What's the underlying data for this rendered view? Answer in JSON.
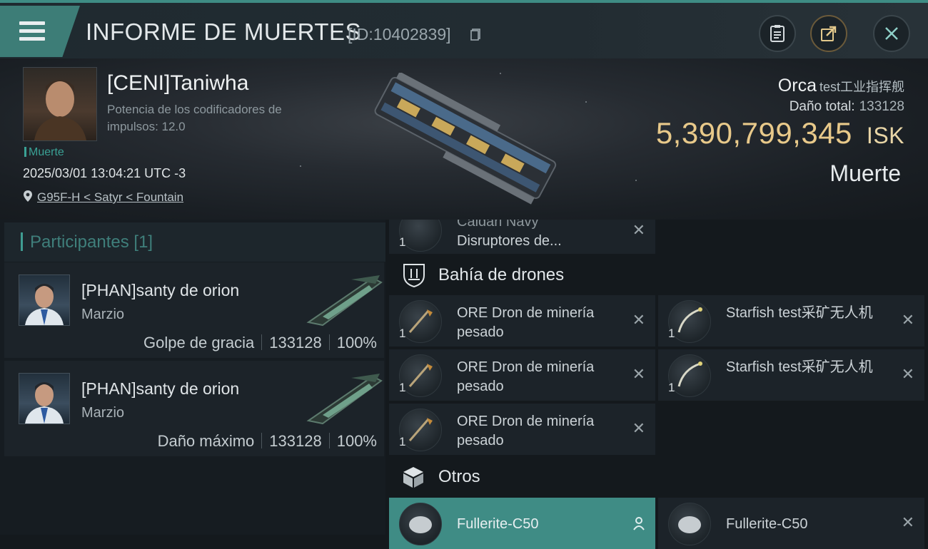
{
  "header": {
    "title": "INFORME DE MUERTES",
    "kill_id": "[ID:10402839]"
  },
  "victim": {
    "name": "[CENI]Taniwha",
    "ship_attribute": "Potencia de los codificadores de impulsos: 12.0",
    "badge": "Muerte",
    "datetime": "2025/03/01 13:04:21 UTC -3",
    "location": "G95F-H < Satyr < Fountain",
    "ship_name": "Orca",
    "ship_subtitle": "test工业指挥舰",
    "damage_label": "Daño total:",
    "damage_value": "133128",
    "isk_value": "5,390,799,345",
    "isk_unit": "ISK",
    "result": "Muerte"
  },
  "participants": {
    "title": "Participantes [1]",
    "rows": [
      {
        "name": "[PHAN]santy de orion",
        "ship": "Marzio",
        "role": "Golpe de gracia",
        "damage": "133128",
        "percent": "100%"
      },
      {
        "name": "[PHAN]santy de orion",
        "ship": "Marzio",
        "role": "Daño máximo",
        "damage": "133128",
        "percent": "100%"
      }
    ]
  },
  "items": {
    "partial_item": {
      "qty": "1",
      "name_line1": "Caldari Navy",
      "name_line2": "Disruptores de..."
    },
    "drone_bay_title": "Bahía de drones",
    "drones": [
      {
        "qty": "1",
        "name": "ORE Dron de minería pesado"
      },
      {
        "qty": "1",
        "name": "Starfish test采矿无人机"
      },
      {
        "qty": "1",
        "name": "ORE Dron de minería pesado"
      },
      {
        "qty": "1",
        "name": "Starfish test采矿无人机"
      },
      {
        "qty": "1",
        "name": "ORE Dron de minería pesado"
      }
    ],
    "other_title": "Otros",
    "others": [
      {
        "name": "Fullerite-C50"
      },
      {
        "name": "Fullerite-C50"
      }
    ],
    "remove_glyph": "✕"
  },
  "icons": {
    "menu": "menu-icon",
    "copy": "copy-icon",
    "clipboard": "clipboard-icon",
    "share": "share-icon",
    "close": "close-icon",
    "location": "location-pin-icon",
    "drone_bay": "drone-bay-icon",
    "other": "cube-icon",
    "pilot": "pilot-icon"
  },
  "colors": {
    "accent": "#3f8c85",
    "isk": "#e8c98a",
    "badge": "#3aa195"
  }
}
